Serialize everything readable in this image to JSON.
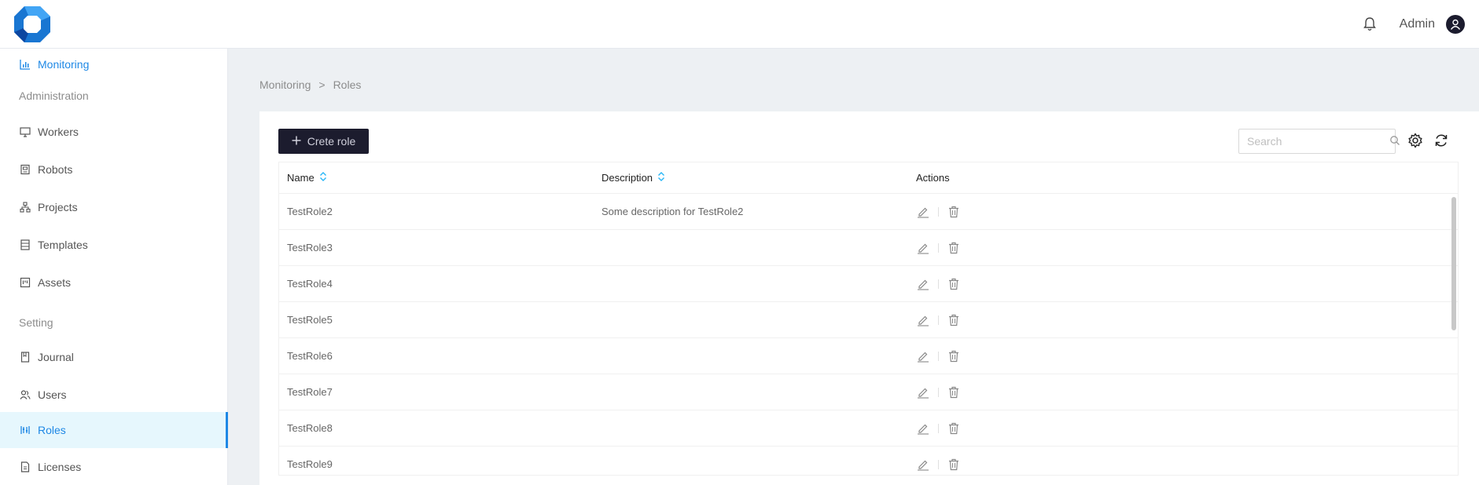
{
  "header": {
    "logo_icon": "octagon-logo-icon",
    "bell_icon": "bell-icon",
    "user_name": "Admin",
    "avatar_icon": "user-avatar-icon"
  },
  "sidebar": {
    "top_item": {
      "label": "Monitoring",
      "icon": "bar-chart-icon"
    },
    "sections": [
      {
        "title": "Administration",
        "items": [
          {
            "label": "Workers",
            "icon": "monitor-icon"
          },
          {
            "label": "Robots",
            "icon": "robot-icon"
          },
          {
            "label": "Projects",
            "icon": "sitemap-icon"
          },
          {
            "label": "Templates",
            "icon": "template-icon"
          },
          {
            "label": "Assets",
            "icon": "assets-icon"
          }
        ]
      },
      {
        "title": "Setting",
        "items": [
          {
            "label": "Journal",
            "icon": "book-icon"
          },
          {
            "label": "Users",
            "icon": "users-icon"
          },
          {
            "label": "Roles",
            "icon": "roles-icon",
            "selected": true
          },
          {
            "label": "Licenses",
            "icon": "license-icon"
          }
        ]
      }
    ]
  },
  "breadcrumb": {
    "parent": "Monitoring",
    "separator": ">",
    "current": "Roles"
  },
  "toolbar": {
    "create_label": "Crete role",
    "search_placeholder": "Search",
    "settings_icon": "gear-icon",
    "refresh_icon": "refresh-icon"
  },
  "table": {
    "columns": [
      "Name",
      "Description",
      "Actions"
    ],
    "rows": [
      {
        "name": "TestRole2",
        "description": "Some description for TestRole2"
      },
      {
        "name": "TestRole3",
        "description": ""
      },
      {
        "name": "TestRole4",
        "description": ""
      },
      {
        "name": "TestRole5",
        "description": ""
      },
      {
        "name": "TestRole6",
        "description": ""
      },
      {
        "name": "TestRole7",
        "description": ""
      },
      {
        "name": "TestRole8",
        "description": ""
      },
      {
        "name": "TestRole9",
        "description": ""
      }
    ]
  },
  "colors": {
    "accent": "#1e88e5",
    "dark_button": "#1c1c2e",
    "content_bg": "#edf0f3",
    "selected_bg": "#e6f7fd"
  }
}
